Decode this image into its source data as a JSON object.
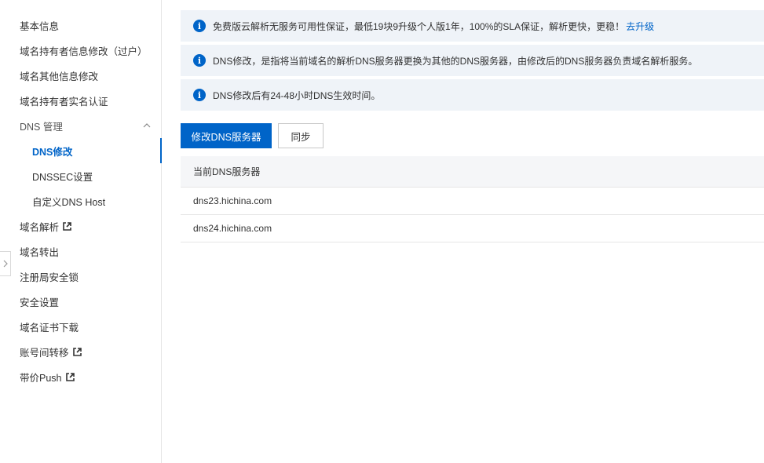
{
  "sidebar": {
    "items": [
      {
        "label": "基本信息"
      },
      {
        "label": "域名持有者信息修改（过户）"
      },
      {
        "label": "域名其他信息修改"
      },
      {
        "label": "域名持有者实名认证"
      },
      {
        "label": "DNS 管理"
      },
      {
        "label": "DNS修改"
      },
      {
        "label": "DNSSEC设置"
      },
      {
        "label": "自定义DNS Host"
      },
      {
        "label": "域名解析"
      },
      {
        "label": "域名转出"
      },
      {
        "label": "注册局安全锁"
      },
      {
        "label": "安全设置"
      },
      {
        "label": "域名证书下载"
      },
      {
        "label": "账号间转移"
      },
      {
        "label": "带价Push"
      }
    ]
  },
  "alerts": {
    "a1": {
      "text": "免费版云解析无服务可用性保证，最低19块9升级个人版1年，100%的SLA保证，解析更快，更稳！",
      "link": "去升级"
    },
    "a2": {
      "text": "DNS修改，是指将当前域名的解析DNS服务器更换为其他的DNS服务器，由修改后的DNS服务器负责域名解析服务。"
    },
    "a3": {
      "text": "DNS修改后有24-48小时DNS生效时间。"
    },
    "icon_glyph": "i"
  },
  "toolbar": {
    "modify_label": "修改DNS服务器",
    "sync_label": "同步"
  },
  "table": {
    "header": "当前DNS服务器",
    "rows": [
      "dns23.hichina.com",
      "dns24.hichina.com"
    ]
  },
  "colors": {
    "accent": "#0064c8",
    "alert_bg": "#eff3f8"
  }
}
